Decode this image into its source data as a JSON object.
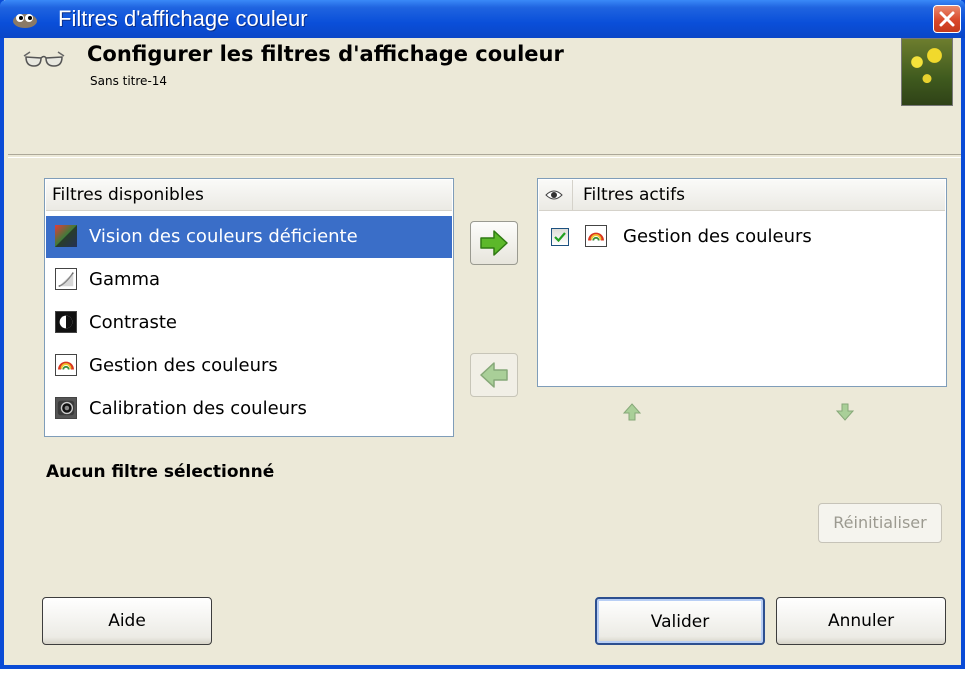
{
  "window": {
    "title": "Filtres d'affichage couleur",
    "close_icon": "close-icon"
  },
  "header": {
    "title": "Configurer les filtres d'affichage couleur",
    "subtitle": "Sans titre-14"
  },
  "available": {
    "header": "Filtres disponibles",
    "items": [
      {
        "label": "Vision des couleurs déficiente",
        "icon": "color-deficient-vision-icon",
        "selected": true
      },
      {
        "label": "Gamma",
        "icon": "gamma-icon",
        "selected": false
      },
      {
        "label": "Contraste",
        "icon": "contrast-icon",
        "selected": false
      },
      {
        "label": "Gestion des couleurs",
        "icon": "color-management-icon",
        "selected": false
      },
      {
        "label": "Calibration des couleurs",
        "icon": "color-calibration-icon",
        "selected": false
      }
    ]
  },
  "active": {
    "header": "Filtres actifs",
    "items": [
      {
        "label": "Gestion des couleurs",
        "checked": true,
        "icon": "color-management-icon"
      }
    ]
  },
  "status": "Aucun filtre sélectionné",
  "buttons": {
    "reset": "Réinitialiser",
    "help": "Aide",
    "ok": "Valider",
    "cancel": "Annuler"
  },
  "colors": {
    "titlebar": "#0a4fd9",
    "selection": "#3a6ec8",
    "arrow_green": "#5cb82a",
    "dialog_bg": "#ece9d8"
  }
}
